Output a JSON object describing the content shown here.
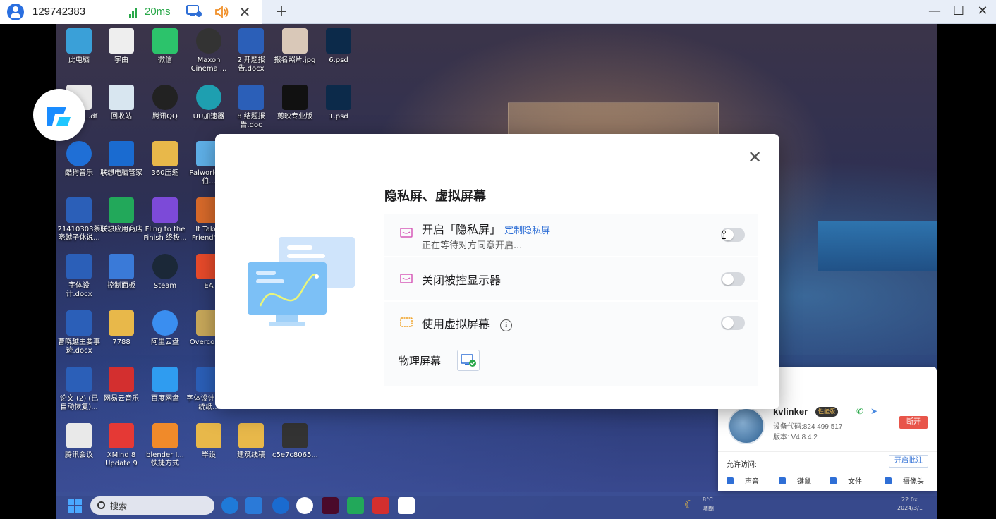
{
  "titlebar": {
    "connection_id": "129742383",
    "ping": "20ms",
    "close_tab": "✕",
    "new_tab": "+",
    "window_controls": [
      "—",
      "☐",
      "✕"
    ],
    "colors": {
      "ping": "#2aa84a",
      "accent": "#2f6fd6"
    }
  },
  "desktop": {
    "icons": [
      {
        "label": "此电脑"
      },
      {
        "label": "字由"
      },
      {
        "label": "微信"
      },
      {
        "label": "Maxon Cinema ..."
      },
      {
        "label": "2 开题报告.docx"
      },
      {
        "label": "报名照片.jpg"
      },
      {
        "label": "6.psd"
      },
      {
        "label": "...标准 ...df"
      },
      {
        "label": "回收站"
      },
      {
        "label": "腾讯QQ"
      },
      {
        "label": "UU加速器"
      },
      {
        "label": "8 结题报告.doc"
      },
      {
        "label": "剪映专业版"
      },
      {
        "label": "1.psd"
      },
      {
        "label": "酷狗音乐"
      },
      {
        "label": "联想电脑管家"
      },
      {
        "label": "360压缩"
      },
      {
        "label": "Palworld 画伯..."
      },
      {
        "label": "21410303蔡晓越子休说..."
      },
      {
        "label": "联想应用商店"
      },
      {
        "label": "Fling to the Finish 终极..."
      },
      {
        "label": "It Takes Friend's..."
      },
      {
        "label": "字体设计.docx"
      },
      {
        "label": "控制面板"
      },
      {
        "label": "Steam"
      },
      {
        "label": "EA"
      },
      {
        "label": "曹晓越主要事迹.docx"
      },
      {
        "label": "7788"
      },
      {
        "label": "阿里云盘"
      },
      {
        "label": "Overco... 2"
      },
      {
        "label": "论文 (2) (已自动恢复)..."
      },
      {
        "label": "网易云音乐"
      },
      {
        "label": "百度网盘"
      },
      {
        "label": "字体设计 国传统纸..."
      },
      {
        "label": "腾讯会议"
      },
      {
        "label": "XMind 8 Update 9"
      },
      {
        "label": "blender I... 快捷方式"
      },
      {
        "label": "毕设"
      },
      {
        "label": "建筑线稿"
      },
      {
        "label": "c5e7c8065..."
      }
    ]
  },
  "taskbar": {
    "search_placeholder": "搜索",
    "weather_temp": "8°C",
    "weather_desc": "晴朗",
    "time": "22:0x",
    "date": "2024/3/1"
  },
  "remote_panel": {
    "name": "kvlinker",
    "badge": "性能版",
    "device_code": "设备代码:824 499 517",
    "version": "版本: V4.8.4.2",
    "disconnect": "断开",
    "allow_access": "允许访问:",
    "annotate": "开启批注",
    "permissions": [
      "声音",
      "键鼠",
      "文件",
      "摄像头"
    ]
  },
  "modal": {
    "title": "隐私屏、虚拟屏幕",
    "close": "✕",
    "privacy": {
      "label": "开启「隐私屏」",
      "custom_link": "定制隐私屏",
      "status": "正在等待对方同意开启..."
    },
    "monitor_off": {
      "label": "关闭被控显示器"
    },
    "virtual": {
      "label": "使用虚拟屏幕",
      "info": "i"
    },
    "physical_screen_label": "物理屏幕"
  }
}
